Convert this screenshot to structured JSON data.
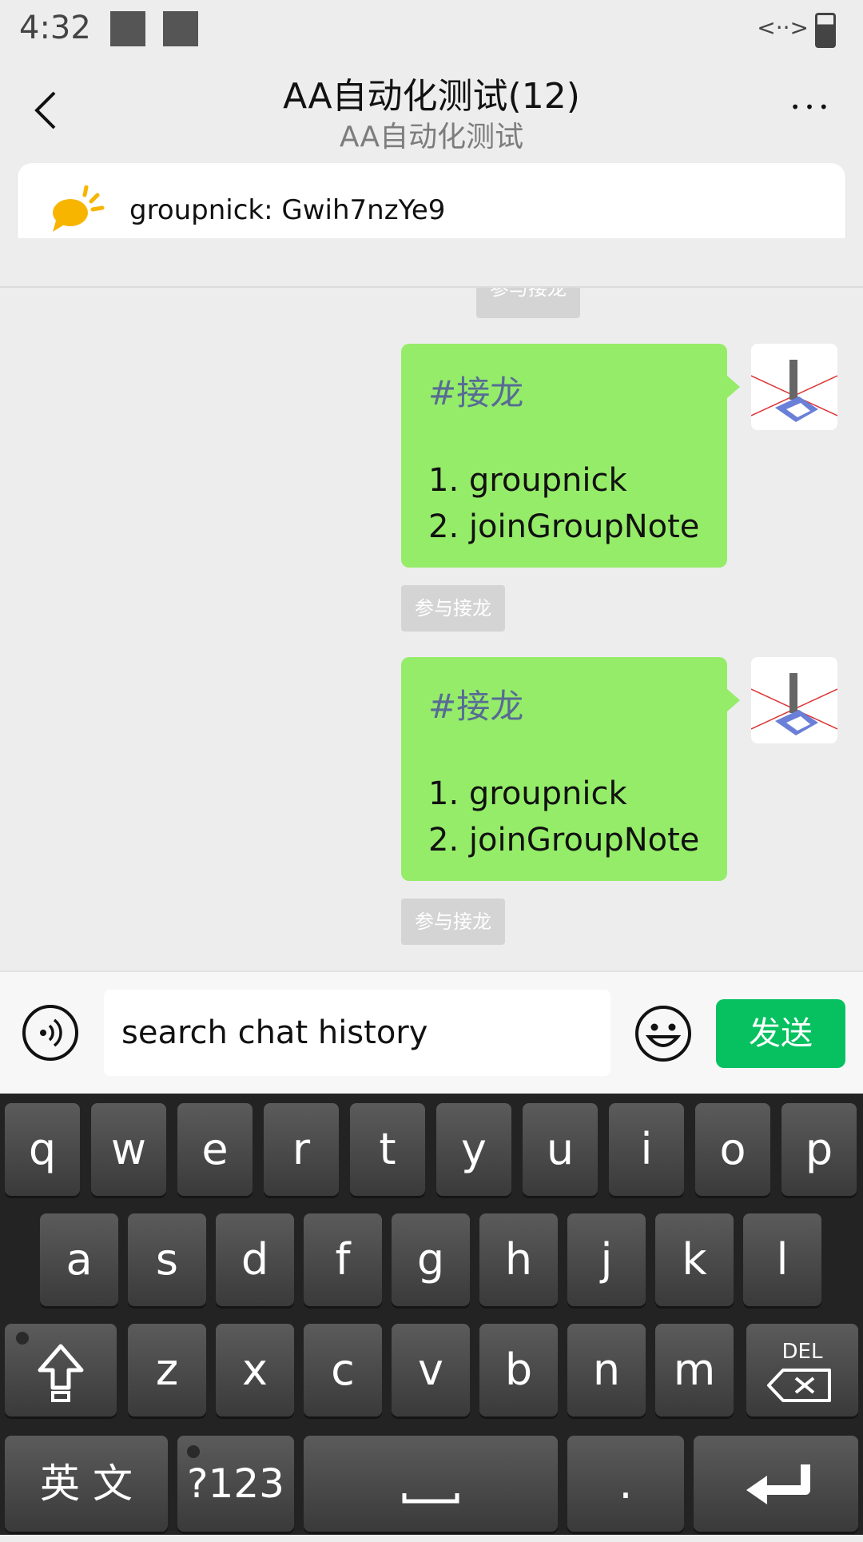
{
  "status_bar": {
    "time": "4:32",
    "link_icon": "<··>"
  },
  "header": {
    "title": "AA自动化测试(12)",
    "subtitle": "AA自动化测试",
    "more": "•••"
  },
  "notice": {
    "text": "groupnick: Gwih7nzYe9"
  },
  "chat": {
    "top_tag": "参与接龙",
    "messages": [
      {
        "hashtag": "#接龙",
        "line1": "1. groupnick",
        "line2": "2. joinGroupNote",
        "tag": "参与接龙"
      },
      {
        "hashtag": "#接龙",
        "line1": "1. groupnick",
        "line2": "2. joinGroupNote",
        "tag": "参与接龙"
      }
    ]
  },
  "input": {
    "value": "search chat history",
    "send_label": "发送"
  },
  "keyboard": {
    "row1": [
      "q",
      "w",
      "e",
      "r",
      "t",
      "y",
      "u",
      "i",
      "o",
      "p"
    ],
    "row2": [
      "a",
      "s",
      "d",
      "f",
      "g",
      "h",
      "j",
      "k",
      "l"
    ],
    "row3": [
      "z",
      "x",
      "c",
      "v",
      "b",
      "n",
      "m"
    ],
    "del_label": "DEL",
    "lang_label": "英 文",
    "sym_label": "?123",
    "period_label": "."
  },
  "colors": {
    "accent": "#07c160",
    "bubble": "#95ec69",
    "hashtag": "#576b95"
  }
}
